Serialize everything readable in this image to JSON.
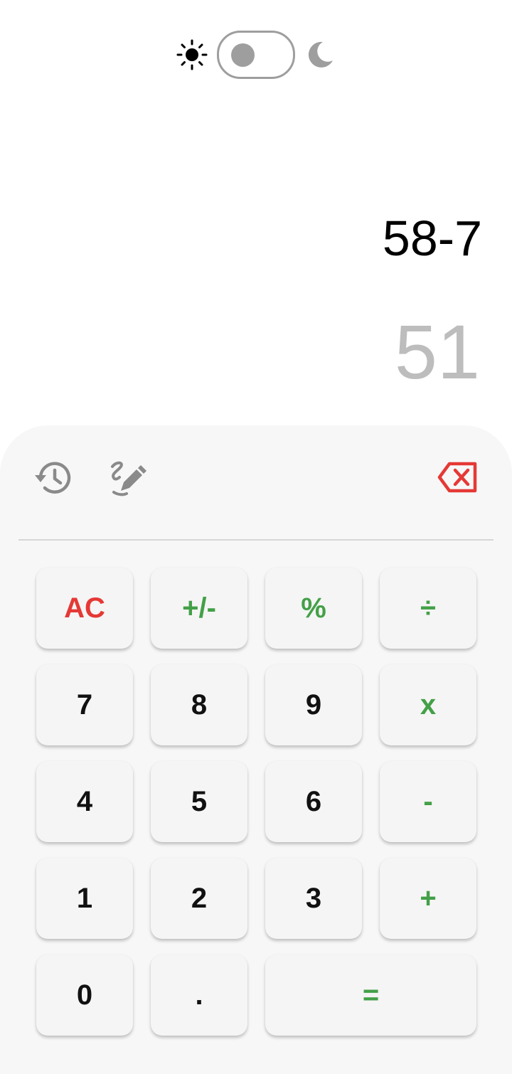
{
  "theme_toggle": {
    "light_icon": "sun-icon",
    "dark_icon": "moon-icon",
    "mode": "light"
  },
  "display": {
    "expression": "58-7",
    "result": "51"
  },
  "toolbar": {
    "history_icon": "history-icon",
    "edit_icon": "edit-icon",
    "backspace_icon": "backspace-icon"
  },
  "colors": {
    "accent_green": "#43a047",
    "accent_red": "#e53935",
    "result_gray": "#bdbdbd",
    "icon_gray": "#9e9e9e"
  },
  "keys": {
    "ac": "AC",
    "plus_minus": "+/-",
    "percent": "%",
    "divide": "÷",
    "seven": "7",
    "eight": "8",
    "nine": "9",
    "multiply": "x",
    "four": "4",
    "five": "5",
    "six": "6",
    "minus": "-",
    "one": "1",
    "two": "2",
    "three": "3",
    "plus": "+",
    "zero": "0",
    "decimal": ".",
    "equals": "="
  }
}
